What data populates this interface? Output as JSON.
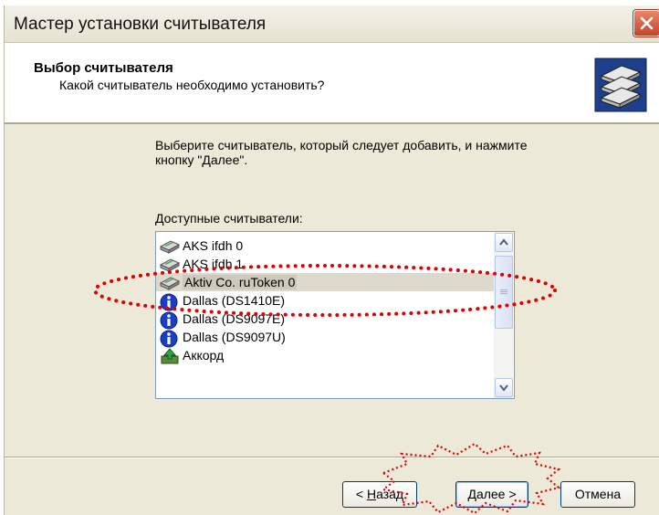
{
  "window": {
    "title": "Мастер установки считывателя"
  },
  "header": {
    "title": "Выбор считывателя",
    "subtitle": "Какой считыватель необходимо установить?",
    "icon": "reader-stack-icon"
  },
  "body": {
    "instruction": "Выберите считыватель, который следует добавить, и нажмите кнопку \"Далее\".",
    "list_label": "Доступные считыватели:"
  },
  "readers": [
    {
      "label": "AKS ifdh 0",
      "icon": "card-reader-icon"
    },
    {
      "label": "AKS ifdh 1",
      "icon": "card-reader-icon"
    },
    {
      "label": "Aktiv Co. ruToken 0",
      "icon": "card-reader-icon",
      "selected": true
    },
    {
      "label": "Dallas (DS1410E)",
      "icon": "info-icon"
    },
    {
      "label": "Dallas (DS9097E)",
      "icon": "info-icon"
    },
    {
      "label": "Dallas (DS9097U)",
      "icon": "info-icon"
    },
    {
      "label": "Аккорд",
      "icon": "green-arrow-icon"
    }
  ],
  "buttons": {
    "back": {
      "prefix": "< ",
      "mnemonic": "Н",
      "rest": "азад"
    },
    "next": {
      "mnemonic": "Д",
      "rest": "алее >"
    },
    "cancel": {
      "label": "Отмена"
    }
  },
  "colors": {
    "dialog_bg": "#ece9d8",
    "selection": "#cdc9bc",
    "annotation": "#e00000",
    "close_button": "#c5432a",
    "info_icon": "#1a3fc4"
  }
}
